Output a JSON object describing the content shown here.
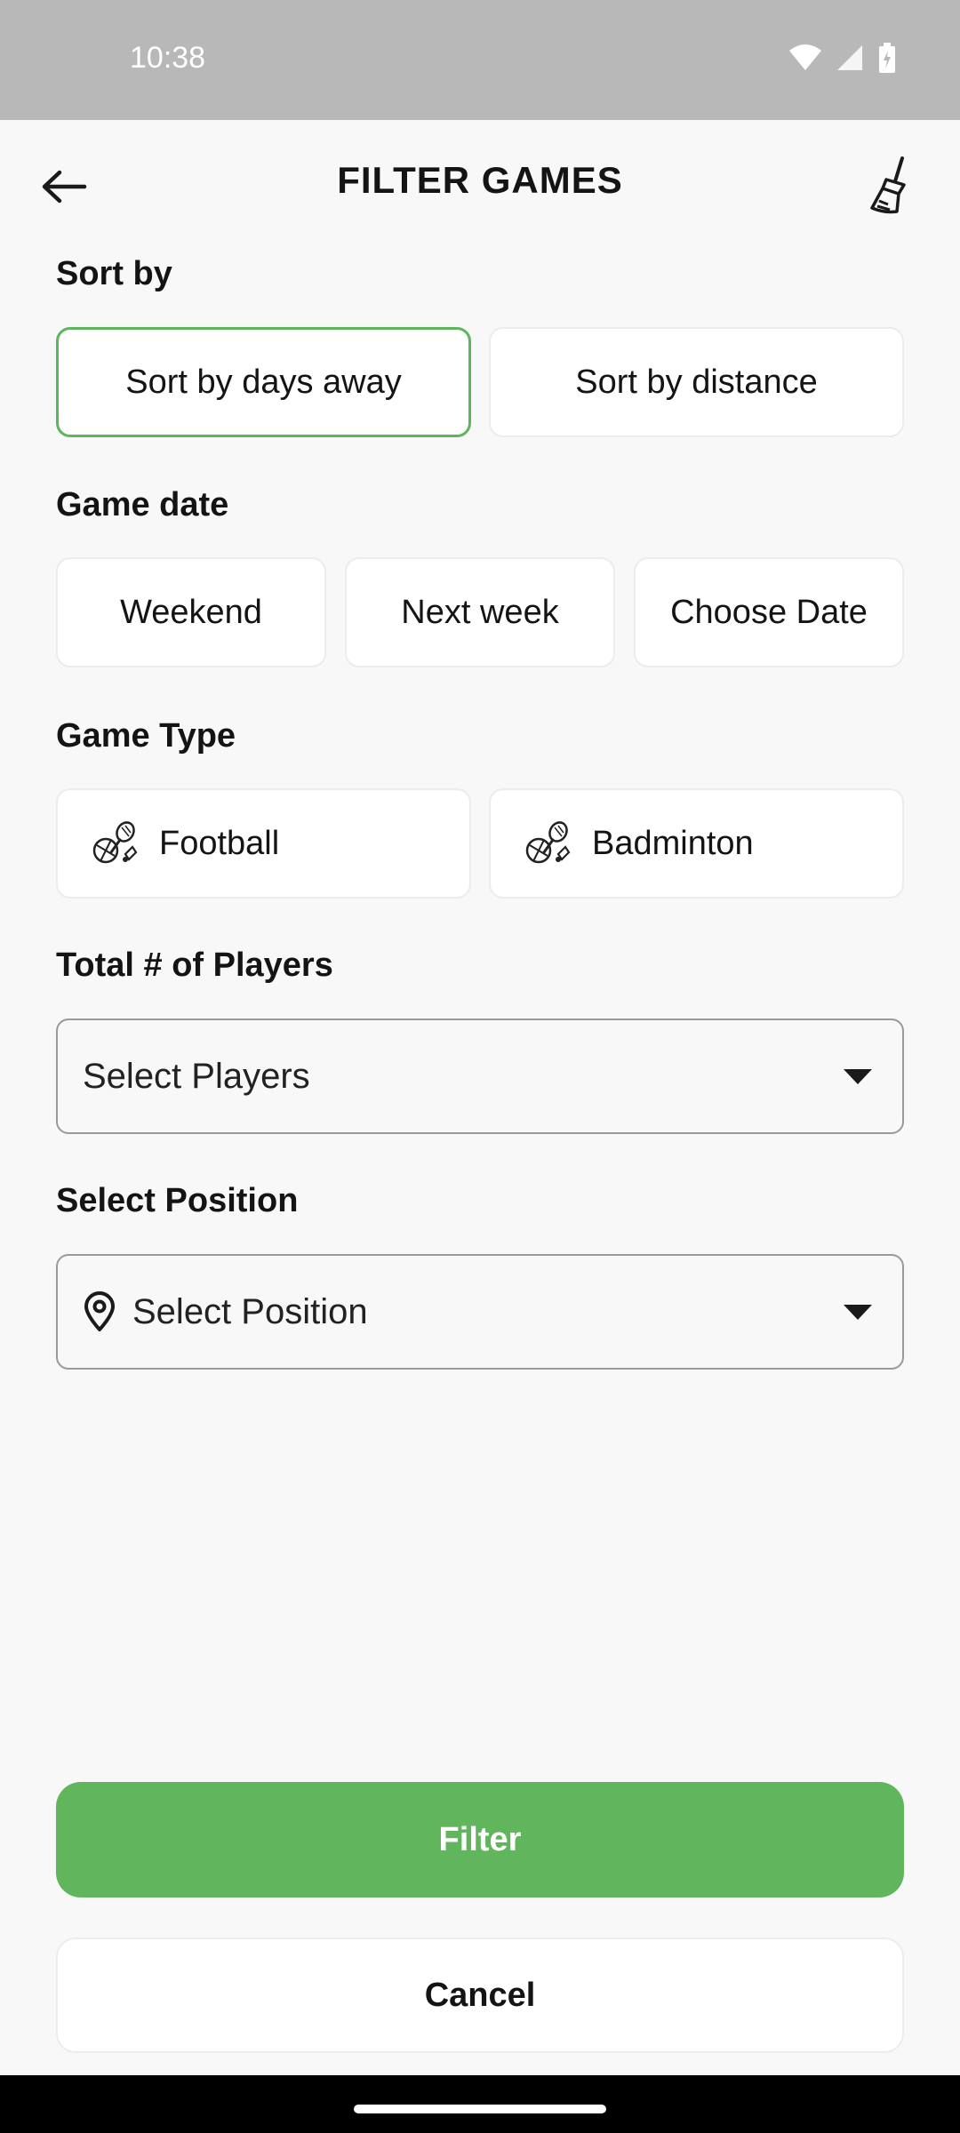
{
  "status_bar": {
    "time": "10:38"
  },
  "header": {
    "title": "FILTER GAMES"
  },
  "sections": {
    "sort_by": {
      "label": "Sort by",
      "options": [
        "Sort by days away",
        "Sort by distance"
      ],
      "selected": "Sort by days away"
    },
    "game_date": {
      "label": "Game date",
      "options": [
        "Weekend",
        "Next week",
        "Choose Date"
      ]
    },
    "game_type": {
      "label": "Game Type",
      "options": [
        "Football",
        "Badminton"
      ]
    },
    "players": {
      "label": "Total # of Players",
      "placeholder": "Select Players"
    },
    "position": {
      "label": "Select Position",
      "placeholder": "Select Position"
    }
  },
  "actions": {
    "filter": "Filter",
    "cancel": "Cancel"
  },
  "colors": {
    "accent": "#61b55c",
    "selected_border": "#5db55d",
    "background": "#f8f8f8"
  },
  "icons": {
    "back": "arrow-left-icon",
    "clear": "broom-icon",
    "sport": "sports-equipment-icon",
    "location": "location-pin-icon",
    "dropdown": "caret-down-icon"
  }
}
